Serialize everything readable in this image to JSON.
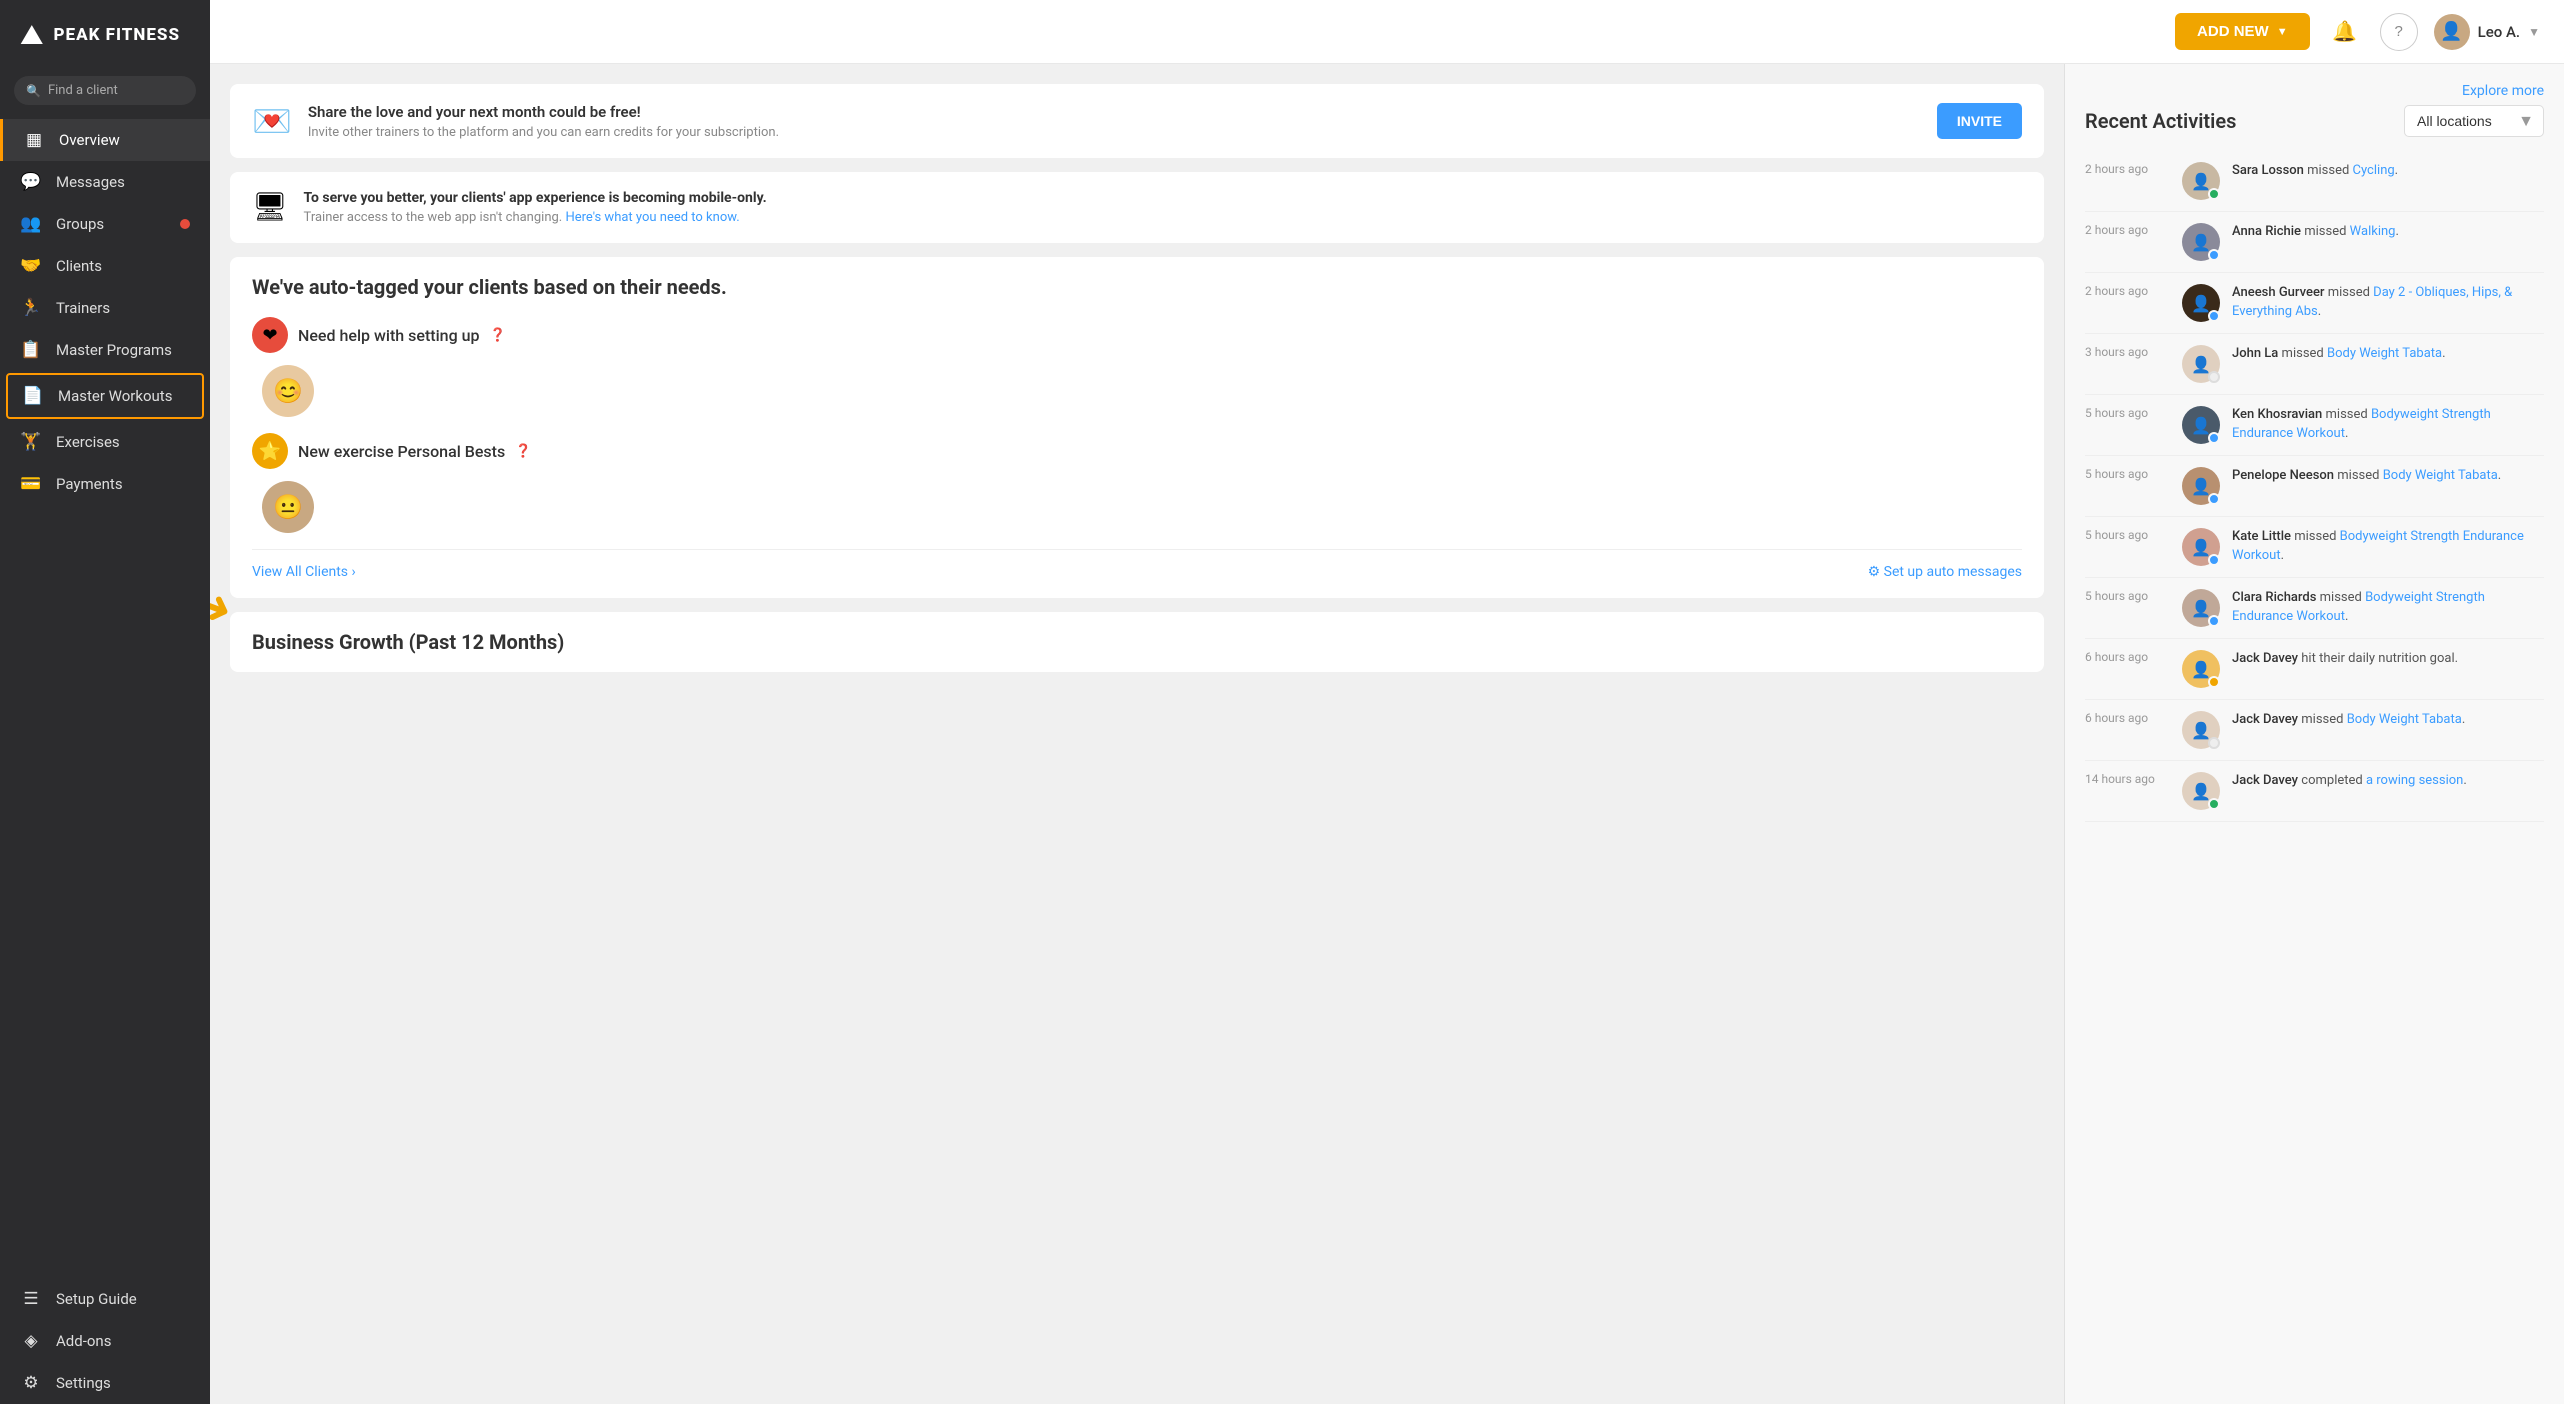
{
  "app": {
    "name": "PEAK FITNESS",
    "logo_symbol": "⛰"
  },
  "sidebar": {
    "search_placeholder": "Find a client",
    "items": [
      {
        "id": "overview",
        "label": "Overview",
        "icon": "▦",
        "active": true,
        "badge": false
      },
      {
        "id": "messages",
        "label": "Messages",
        "icon": "💬",
        "active": false,
        "badge": false
      },
      {
        "id": "groups",
        "label": "Groups",
        "icon": "👥",
        "active": false,
        "badge": true
      },
      {
        "id": "clients",
        "label": "Clients",
        "icon": "🤝",
        "active": false,
        "badge": false
      },
      {
        "id": "trainers",
        "label": "Trainers",
        "icon": "🏃",
        "active": false,
        "badge": false
      },
      {
        "id": "master-programs",
        "label": "Master Programs",
        "icon": "📋",
        "active": false,
        "badge": false
      },
      {
        "id": "master-workouts",
        "label": "Master Workouts",
        "icon": "📄",
        "active": false,
        "badge": false,
        "selected": true
      },
      {
        "id": "exercises",
        "label": "Exercises",
        "icon": "🏋",
        "active": false,
        "badge": false
      },
      {
        "id": "payments",
        "label": "Payments",
        "icon": "💳",
        "active": false,
        "badge": false
      }
    ],
    "bottom_items": [
      {
        "id": "setup-guide",
        "label": "Setup Guide",
        "icon": "☰"
      },
      {
        "id": "add-ons",
        "label": "Add-ons",
        "icon": "◈"
      },
      {
        "id": "settings",
        "label": "Settings",
        "icon": "⚙"
      }
    ]
  },
  "header": {
    "add_new_label": "ADD NEW",
    "user_name": "Leo A."
  },
  "promo_card": {
    "title": "Share the love and your next month could be free!",
    "description": "Invite other trainers to the platform and you can earn credits for your subscription.",
    "button_label": "INVITE"
  },
  "info_card": {
    "title": "To serve you better, your clients' app experience is becoming mobile-only.",
    "description": "Trainer access to the web app isn't changing.",
    "link_text": "Here's what you need to know."
  },
  "tagged_card": {
    "title": "We've auto-tagged your clients based on their needs.",
    "sections": [
      {
        "label": "Need help with setting up",
        "badge_type": "red",
        "badge_icon": "❤",
        "has_client": true
      },
      {
        "label": "New exercise Personal Bests",
        "badge_type": "yellow",
        "badge_icon": "⭐",
        "has_client": true
      }
    ],
    "view_all_label": "View All Clients ›",
    "setup_label": "⚙ Set up auto messages"
  },
  "business_card": {
    "title": "Business Growth (Past 12 Months)"
  },
  "right_panel": {
    "explore_more": "Explore more",
    "title": "Recent Activities",
    "location_label": "All locations",
    "activities": [
      {
        "time": "2 hours ago",
        "user": "Sara Losson",
        "action": "missed",
        "item": "Cycling",
        "status": "green"
      },
      {
        "time": "2 hours ago",
        "user": "Anna Richie",
        "action": "missed",
        "item": "Walking",
        "status": "blue"
      },
      {
        "time": "2 hours ago",
        "user": "Aneesh Gurveer",
        "action": "missed",
        "item": "Day 2 - Obliques, Hips, & Everything Abs",
        "status": "blue"
      },
      {
        "time": "3 hours ago",
        "user": "John La",
        "action": "missed",
        "item": "Body Weight Tabata",
        "status": "empty"
      },
      {
        "time": "5 hours ago",
        "user": "Ken Khosravian",
        "action": "missed",
        "item": "Bodyweight Strength Endurance Workout",
        "status": "blue"
      },
      {
        "time": "5 hours ago",
        "user": "Penelope Neeson",
        "action": "missed",
        "item": "Body Weight Tabata",
        "status": "blue"
      },
      {
        "time": "5 hours ago",
        "user": "Kate Little",
        "action": "missed",
        "item": "Bodyweight Strength Endurance Workout",
        "status": "blue"
      },
      {
        "time": "5 hours ago",
        "user": "Clara Richards",
        "action": "missed",
        "item": "Bodyweight Strength Endurance Workout",
        "status": "blue"
      },
      {
        "time": "6 hours ago",
        "user": "Jack Davey",
        "action": "hit their daily nutrition goal.",
        "item": null,
        "status": "yellow"
      },
      {
        "time": "6 hours ago",
        "user": "Jack Davey",
        "action": "missed",
        "item": "Body Weight Tabata",
        "status": "empty"
      },
      {
        "time": "14 hours ago",
        "user": "Jack Davey",
        "action": "completed",
        "item": "a rowing session",
        "status": "green"
      }
    ]
  }
}
